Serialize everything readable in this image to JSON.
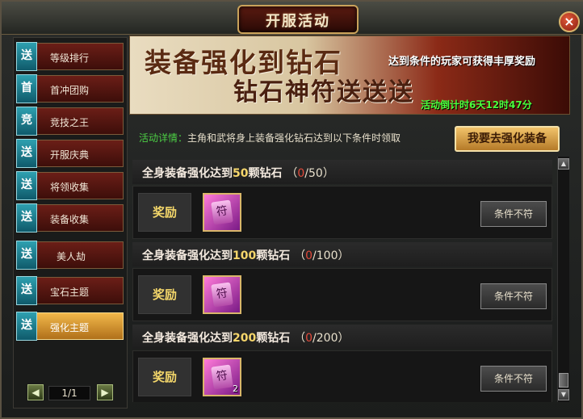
{
  "window": {
    "title": "开服活动",
    "close_label": "×"
  },
  "sidebar": {
    "items": [
      {
        "badge": "送",
        "label": "等级排行",
        "active": false
      },
      {
        "badge": "首",
        "label": "首冲团购",
        "active": false
      },
      {
        "badge": "竞",
        "label": "竞技之王",
        "active": false
      },
      {
        "badge": "送",
        "label": "开服庆典",
        "active": false
      },
      {
        "badge": "送",
        "label": "将领收集",
        "active": false
      },
      {
        "badge": "送",
        "label": "装备收集",
        "active": false
      },
      {
        "badge": "送",
        "label": "美人劫",
        "active": false
      },
      {
        "badge": "送",
        "label": "宝石主题",
        "active": false
      },
      {
        "badge": "送",
        "label": "强化主题",
        "active": true
      }
    ],
    "pager": {
      "prev": "◀",
      "next": "▶",
      "text": "1/1"
    }
  },
  "banner": {
    "line1": "装备强化到钻石",
    "line2": "钻石神符送送送",
    "subtitle": "达到条件的玩家可获得丰厚奖励",
    "countdown": "活动倒计时6天12时47分"
  },
  "detail": {
    "label": "活动详情：",
    "text": "主角和武将身上装备强化钻石达到以下条件时领取"
  },
  "go_button": "我要去强化装备",
  "tasks": [
    {
      "prefix": "全身装备强化达到",
      "number": "50",
      "suffix": "颗钻石",
      "open": "（",
      "current": "0",
      "total": "/50）",
      "reward_label": "奖励",
      "reward_qty": "",
      "status": "条件不符"
    },
    {
      "prefix": "全身装备强化达到",
      "number": "100",
      "suffix": "颗钻石",
      "open": "（",
      "current": "0",
      "total": "/100）",
      "reward_label": "奖励",
      "reward_qty": "",
      "status": "条件不符"
    },
    {
      "prefix": "全身装备强化达到",
      "number": "200",
      "suffix": "颗钻石",
      "open": "（",
      "current": "0",
      "total": "/200）",
      "reward_label": "奖励",
      "reward_qty": "2",
      "status": "条件不符"
    }
  ],
  "reward_rune_glyph": "符",
  "scrollbar": {
    "up": "▲",
    "down": "▼"
  }
}
